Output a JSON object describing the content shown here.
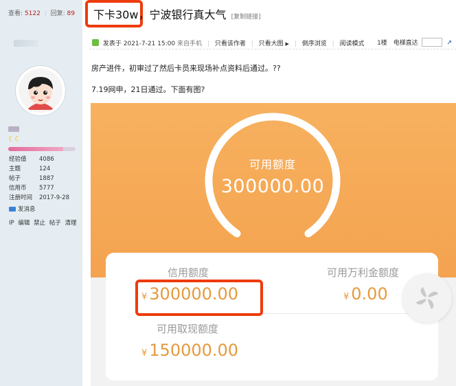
{
  "header": {
    "views_label": "查看:",
    "views_value": "5122",
    "replies_label": "回复:",
    "replies_value": "89",
    "title_highlight": "下卡30w，",
    "title_rest": "宁波银行真大气",
    "copy_link": "[复制链接]"
  },
  "sidebar": {
    "stats": [
      {
        "label": "经验值",
        "value": "4086"
      },
      {
        "label": "主题",
        "value": "124"
      },
      {
        "label": "帖子",
        "value": "1887"
      },
      {
        "label": "信用币",
        "value": "5777"
      },
      {
        "label": "注册时间",
        "value": "2017-9-28"
      }
    ],
    "send_message": "发消息",
    "admin_links": [
      "IP",
      "编辑",
      "禁止",
      "帖子",
      "清理"
    ],
    "rank_progress": 0.82,
    "rank_icon_color": "#f4c11a"
  },
  "post_bar": {
    "posted": "发表于 2021-7-21 15:00",
    "from_mobile": "来自手机",
    "only_author": "只看该作者",
    "only_large_image": "只看大图",
    "reverse": "倒序浏览",
    "reading_mode": "阅读模式",
    "floor": "1楼",
    "elevator": "电梯直达"
  },
  "post": {
    "line1": "房产进件，初审过了然后卡员来现场补点资料后通过。??",
    "line2": "7.19网申，21日通过。下面有图?"
  },
  "app": {
    "gauge_label": "可用额度",
    "gauge_value": "300000.00",
    "credit_label": "信用额度",
    "credit_value": "300000.00",
    "wanli_label": "可用万利金额度",
    "wanli_value": "0.00",
    "cash_label": "可用取现额度",
    "cash_value": "150000.00",
    "currency": "¥"
  },
  "colors": {
    "accent_red": "#ee3b0a",
    "orange": "#f4a34f",
    "amount_orange": "#e59a3e",
    "sidebar_bg": "#e5edf2"
  }
}
